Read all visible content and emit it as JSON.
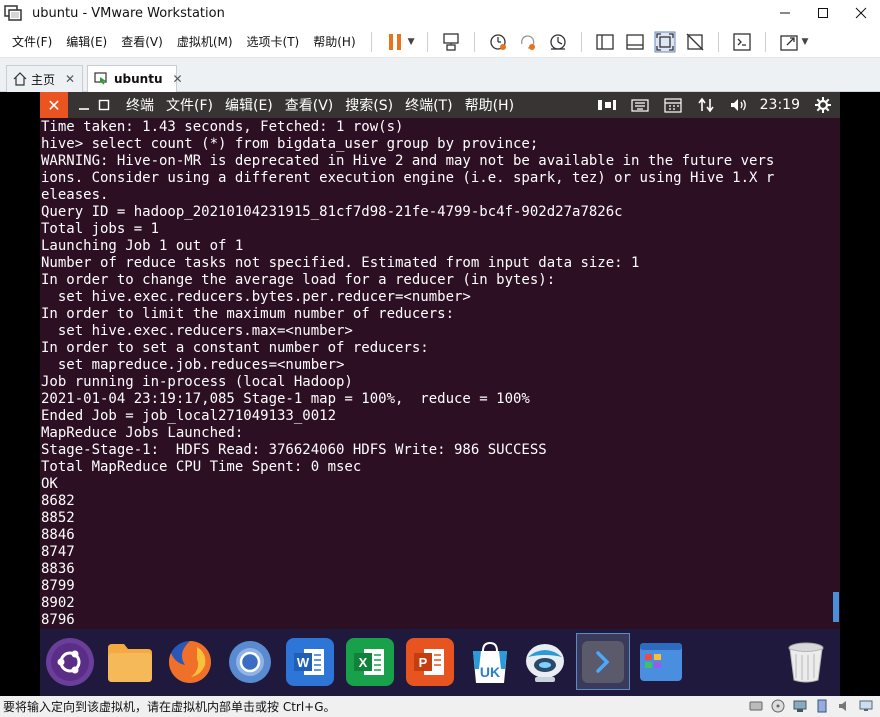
{
  "window": {
    "title": "ubuntu - VMware Workstation"
  },
  "menubar": {
    "items": [
      "文件(F)",
      "编辑(E)",
      "查看(V)",
      "虚拟机(M)",
      "选项卡(T)",
      "帮助(H)"
    ]
  },
  "tabs": [
    {
      "label": "主页",
      "active": false
    },
    {
      "label": "ubuntu",
      "active": true
    }
  ],
  "terminal": {
    "close_glyph": "✕",
    "menu": [
      "终端",
      "文件(F)",
      "编辑(E)",
      "查看(V)",
      "搜索(S)",
      "终端(T)",
      "帮助(H)"
    ],
    "time": "23:19",
    "lines": [
      "Time taken: 1.43 seconds, Fetched: 1 row(s)",
      "hive> select count (*) from bigdata_user group by province;",
      "WARNING: Hive-on-MR is deprecated in Hive 2 and may not be available in the future vers",
      "ions. Consider using a different execution engine (i.e. spark, tez) or using Hive 1.X r",
      "eleases.",
      "Query ID = hadoop_20210104231915_81cf7d98-21fe-4799-bc4f-902d27a7826c",
      "Total jobs = 1",
      "Launching Job 1 out of 1",
      "Number of reduce tasks not specified. Estimated from input data size: 1",
      "In order to change the average load for a reducer (in bytes):",
      "  set hive.exec.reducers.bytes.per.reducer=<number>",
      "In order to limit the maximum number of reducers:",
      "  set hive.exec.reducers.max=<number>",
      "In order to set a constant number of reducers:",
      "  set mapreduce.job.reduces=<number>",
      "Job running in-process (local Hadoop)",
      "2021-01-04 23:19:17,085 Stage-1 map = 100%,  reduce = 100%",
      "Ended Job = job_local271049133_0012",
      "MapReduce Jobs Launched:",
      "Stage-Stage-1:  HDFS Read: 376624060 HDFS Write: 986 SUCCESS",
      "Total MapReduce CPU Time Spent: 0 msec",
      "OK",
      "8682",
      "8852",
      "8846",
      "8747",
      "8836",
      "8799",
      "8902",
      "8796"
    ]
  },
  "dock": {
    "icons": [
      "ubuntu-icon",
      "files-icon",
      "firefox-icon",
      "chromium-icon",
      "wps-writer-icon",
      "wps-spreadsheet-icon",
      "wps-presentation-icon",
      "ubuntu-kylin-store-icon",
      "media-player-icon",
      "terminal-icon",
      "app-grid-icon"
    ],
    "store_label": "UK",
    "writer_letter": "W",
    "spreadsheet_letter": "X",
    "presentation_letter": "P"
  },
  "statusbar": {
    "text": "要将输入定向到该虚拟机，请在虚拟机内部单击或按 Ctrl+G。"
  },
  "colors": {
    "terminal_bg": "#2c0f22",
    "ubuntu_orange": "#e95420",
    "dock_bg": "#1f1a3d"
  }
}
